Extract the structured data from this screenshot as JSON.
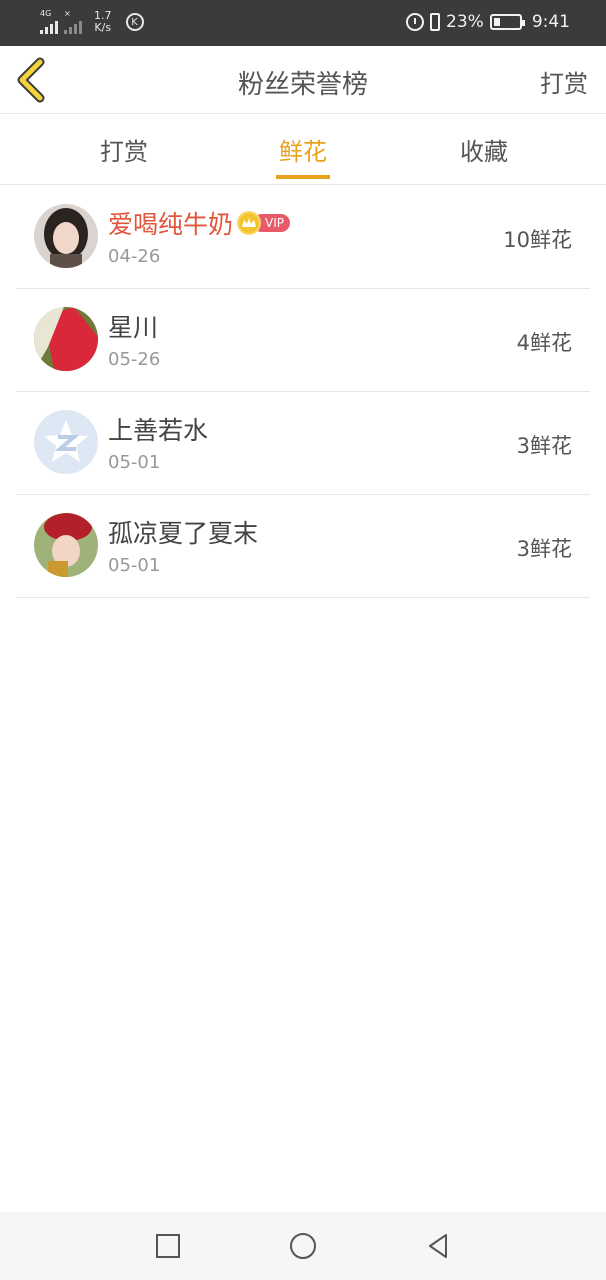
{
  "status_bar": {
    "network_tag": "4G",
    "speed_value": "1.7",
    "speed_unit": "K/s",
    "k_badge": "K",
    "battery_percent": "23%",
    "battery_level": 0.23,
    "time": "9:41",
    "icons": [
      "signal-icon",
      "signal-off-icon",
      "k-icon",
      "alarm-icon",
      "vibrate-icon",
      "battery-icon"
    ]
  },
  "header": {
    "title": "粉丝荣誉榜",
    "action_label": "打赏",
    "back_icon": "chevron-left-icon",
    "back_color": "#e9a21c"
  },
  "tabs": [
    {
      "label": "打赏",
      "active": false
    },
    {
      "label": "鲜花",
      "active": true
    },
    {
      "label": "收藏",
      "active": false
    }
  ],
  "accent_color": "#e9a21c",
  "list": [
    {
      "name": "爱喝纯牛奶",
      "vip": true,
      "vip_label": "VIP",
      "date": "04-26",
      "amount": "10鲜花"
    },
    {
      "name": "星川",
      "vip": false,
      "date": "05-26",
      "amount": "4鲜花"
    },
    {
      "name": "上善若水",
      "vip": false,
      "date": "05-01",
      "amount": "3鲜花"
    },
    {
      "name": "孤凉夏了夏末",
      "vip": false,
      "date": "05-01",
      "amount": "3鲜花"
    }
  ],
  "nav_bar": {
    "icons": [
      "square-icon",
      "circle-icon",
      "triangle-back-icon"
    ]
  }
}
